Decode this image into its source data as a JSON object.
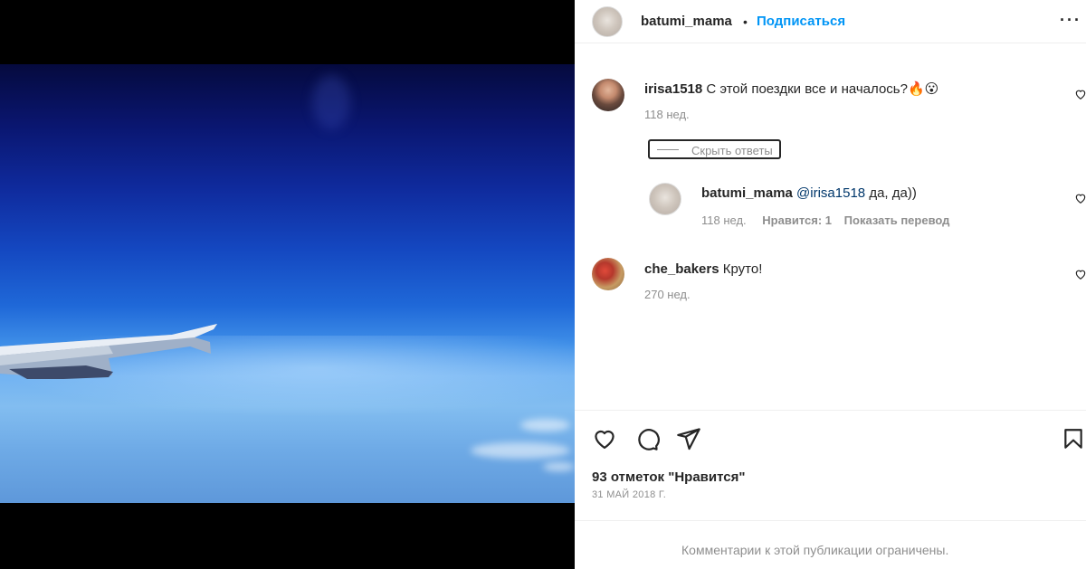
{
  "post": {
    "author": "batumi_mama",
    "dot": "•",
    "follow_label": "Подписаться",
    "likes_text": "93 отметок \"Нравится\"",
    "date": "31 МАЙ 2018 Г.",
    "comments_disabled": "Комментарии к этой публикации ограничены."
  },
  "comments": [
    {
      "username": "irisa1518",
      "text": "С этой поездки все и началось?🔥😮",
      "time": "118 нед.",
      "hide_replies_label": "Скрыть ответы",
      "replies": [
        {
          "username": "batumi_mama",
          "mention": "@irisa1518",
          "text": " да, да))",
          "time": "118 нед.",
          "likes_label": "Нравится: 1",
          "translate_label": "Показать перевод"
        }
      ]
    },
    {
      "username": "che_bakers",
      "text": "Круто!",
      "time": "270 нед."
    }
  ],
  "icons": {
    "like": "heart-icon",
    "comment": "comment-icon",
    "share": "share-icon",
    "save": "bookmark-icon"
  },
  "colors": {
    "link_blue": "#0095f6",
    "mention_blue": "#00376b",
    "muted": "#8e8e8e"
  }
}
